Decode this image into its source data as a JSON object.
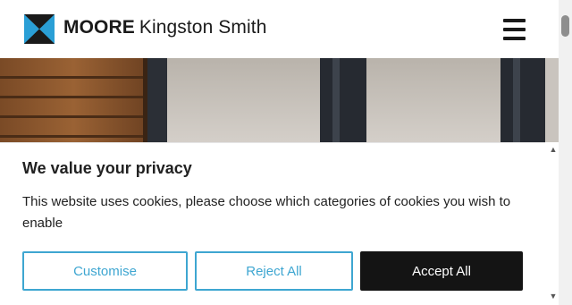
{
  "header": {
    "brand_bold": "MOORE",
    "brand_light": "Kingston Smith",
    "menu_icon": "hamburger-menu-icon"
  },
  "cookie_banner": {
    "title": "We value your privacy",
    "description": "This website uses cookies, please choose which categories of cookies you wish to enable",
    "customise_label": "Customise",
    "reject_label": "Reject All",
    "accept_label": "Accept All"
  },
  "colors": {
    "accent": "#3ea6d1",
    "dark_button": "#141414",
    "logo_blue": "#2a9fd6",
    "logo_dark": "#1a1a1a"
  }
}
